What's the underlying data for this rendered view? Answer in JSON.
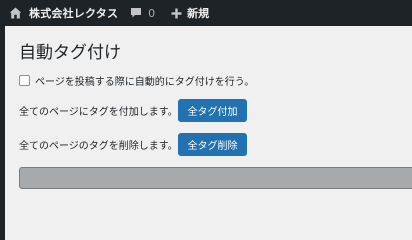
{
  "adminbar": {
    "site_name": "株式会社レクタス",
    "comments_count": "0",
    "new_label": "新規",
    "icons": [
      "home-icon",
      "comment-icon",
      "plus-icon"
    ]
  },
  "page": {
    "title": "自動タグ付け",
    "auto_tag_option_label": "ページを投稿する際に自動的にタグ付けを行う。",
    "auto_tag_option_checked": false,
    "add_all_text": "全てのページにタグを付加します。",
    "add_all_button": "全タグ付加",
    "delete_all_text": "全てのページのタグを削除します。",
    "delete_all_button": "全タグ削除"
  },
  "colors": {
    "adminbar_bg": "#1d2327",
    "button_bg": "#2271b1",
    "progress_bg": "#a7aaad",
    "page_bg": "#f0f0f1"
  }
}
